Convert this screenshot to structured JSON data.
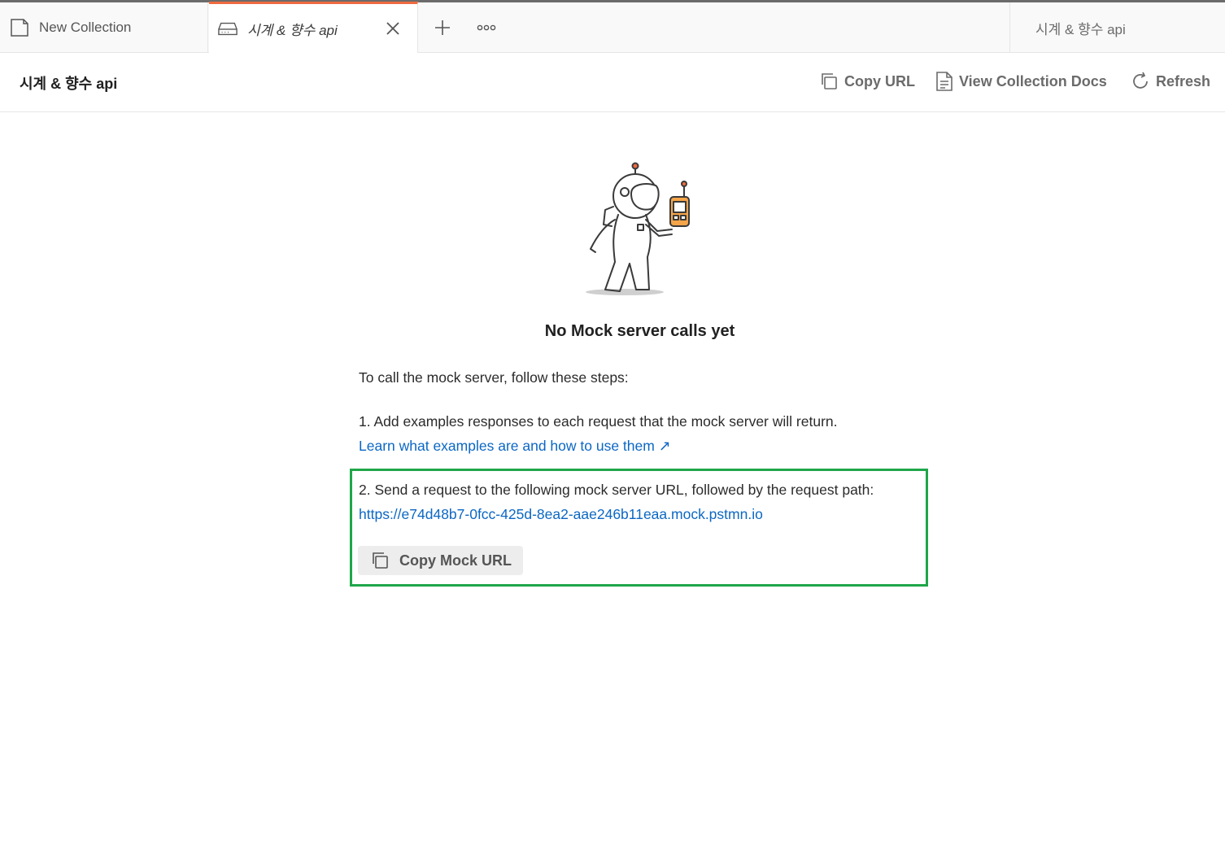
{
  "tabs": {
    "items": [
      {
        "label": "New Collection",
        "icon": "collection-icon",
        "active": false
      },
      {
        "label": "시계 & 향수 api",
        "icon": "mock-server-icon",
        "active": true
      }
    ],
    "add_icon": "plus-icon",
    "more_icon": "more-options-icon",
    "close_icon": "close-icon"
  },
  "environment": {
    "selected": "시계 & 향수 api"
  },
  "header": {
    "title": "시계 & 향수 api",
    "actions": {
      "copy_url": "Copy URL",
      "view_docs": "View Collection Docs",
      "refresh": "Refresh"
    }
  },
  "empty_state": {
    "title": "No Mock server calls yet",
    "intro": "To call the mock server, follow these steps:",
    "step1_text": "1. Add examples responses to each request that the mock server will return.",
    "step1_link": "Learn what examples are and how to use them ↗",
    "step2_text": "2. Send a request to the following mock server URL, followed by the request path:",
    "mock_url": "https://e74d48b7-0fcc-425d-8ea2-aae246b11eaa.mock.pstmn.io",
    "copy_mock_button": "Copy Mock URL"
  },
  "colors": {
    "accent_tab": "#ee6a3f",
    "link": "#0b67c4",
    "highlight_border": "#1fa64a"
  }
}
